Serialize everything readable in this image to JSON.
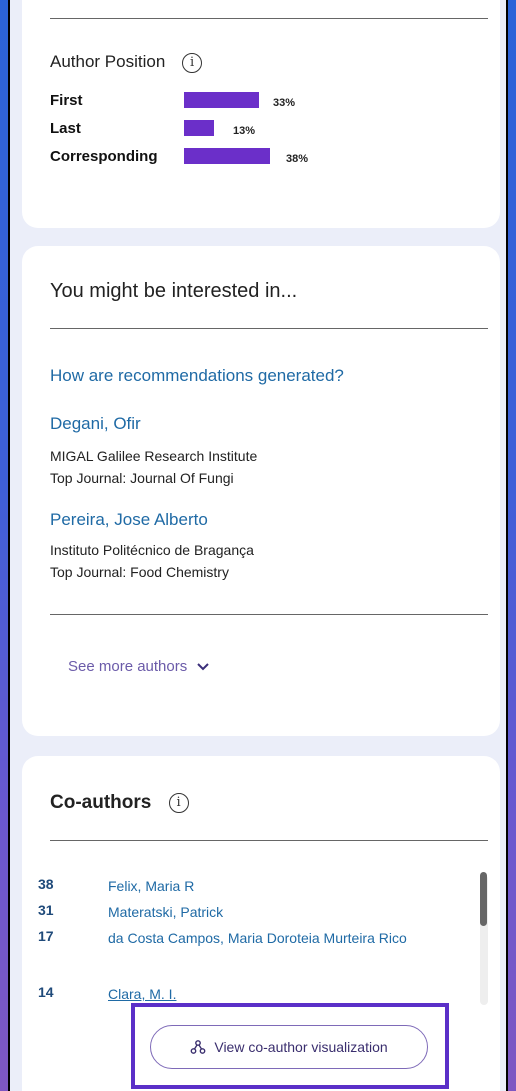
{
  "author_position": {
    "title": "Author Position",
    "rows": [
      {
        "label": "First",
        "percent_label": "33%",
        "value": 33
      },
      {
        "label": "Last",
        "percent_label": "13%",
        "value": 13
      },
      {
        "label": "Corresponding",
        "percent_label": "38%",
        "value": 38
      }
    ],
    "bar_color": "#6b2fc9"
  },
  "recommendations": {
    "title": "You might be interested in...",
    "how_link": "How are recommendations generated?",
    "authors": [
      {
        "name": "Degani, Ofir",
        "institution": "MIGAL Galilee Research Institute",
        "journal": "Top Journal: Journal Of Fungi"
      },
      {
        "name": "Pereira, Jose Alberto",
        "institution": "Instituto Politécnico de Bragança",
        "journal": "Top Journal: Food Chemistry"
      }
    ],
    "see_more": "See more authors"
  },
  "coauthors": {
    "title": "Co-authors",
    "list": [
      {
        "count": "38",
        "name": "Felix, Maria R"
      },
      {
        "count": "31",
        "name": "Materatski, Patrick"
      },
      {
        "count": "17",
        "name": "da Costa Campos, Maria Doroteia Murteira Rico"
      },
      {
        "count": "14",
        "name": "Clara, M. I."
      }
    ],
    "viz_button": "View co-author visualization"
  },
  "icons": {
    "info": "info-icon",
    "chevron": "chevron-down-icon",
    "network": "network-icon"
  }
}
